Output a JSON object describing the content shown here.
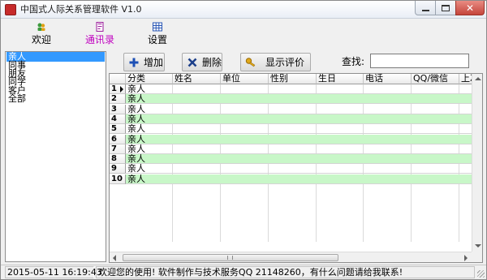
{
  "window": {
    "title": "中国式人际关系管理软件 V1.0"
  },
  "menu": [
    {
      "label": "欢迎",
      "icon": "welcome-icon"
    },
    {
      "label": "通讯录",
      "icon": "contacts-book-icon",
      "active": true
    },
    {
      "label": "设置",
      "icon": "settings-grid-icon"
    }
  ],
  "categories": [
    "亲人",
    "同事",
    "朋友",
    "同学",
    "客户",
    "全部"
  ],
  "selected_category": "亲人",
  "toolbar": {
    "add_label": "增加",
    "delete_label": "删除",
    "review_label": "显示评价",
    "search_label": "查找:",
    "search_value": ""
  },
  "grid": {
    "columns": [
      "分类",
      "姓名",
      "单位",
      "性别",
      "生日",
      "电话",
      "QQ/微信",
      "上次"
    ],
    "rows": [
      {
        "num": "1",
        "category": "亲人",
        "current": true
      },
      {
        "num": "2",
        "category": "亲人"
      },
      {
        "num": "3",
        "category": "亲人"
      },
      {
        "num": "4",
        "category": "亲人"
      },
      {
        "num": "5",
        "category": "亲人"
      },
      {
        "num": "6",
        "category": "亲人"
      },
      {
        "num": "7",
        "category": "亲人"
      },
      {
        "num": "8",
        "category": "亲人"
      },
      {
        "num": "9",
        "category": "亲人"
      },
      {
        "num": "10",
        "category": "亲人"
      }
    ],
    "alt_row_color": "#c8f7c8"
  },
  "status": {
    "datetime": "2015-05-11  16:19:43",
    "message": "欢迎您的使用! 软件制作与技术服务QQ 21148260，有什么问题请给我联系!"
  },
  "colors": {
    "selection": "#3399ff",
    "active_tab_text": "#c000c0",
    "add_icon": "#1c4fb5",
    "delete_icon": "#1c3f8a",
    "key_icon": "#e0a818"
  }
}
